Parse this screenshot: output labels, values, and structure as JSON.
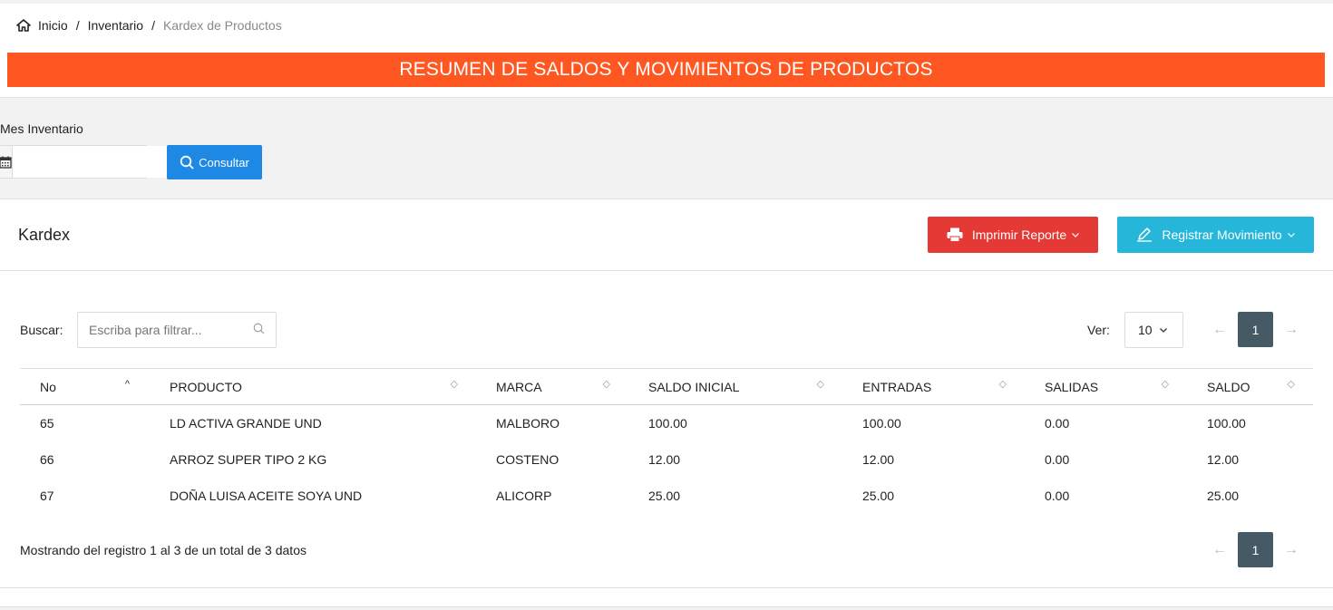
{
  "breadcrumb": {
    "home_icon": "home-icon",
    "items": [
      "Inicio",
      "Inventario",
      "Kardex de Productos"
    ],
    "separator": "/"
  },
  "banner": {
    "title": "RESUMEN DE SALDOS Y MOVIMIENTOS DE PRODUCTOS",
    "color": "#ff5722"
  },
  "filter": {
    "label": "Mes Inventario",
    "date_value": "",
    "calendar_icon": "calendar-icon",
    "consultar_label": "Consultar",
    "consultar_icon": "search-icon"
  },
  "card": {
    "title": "Kardex",
    "imprimir_label": "Imprimir Reporte",
    "imprimir_icon": "printer-icon",
    "registrar_label": "Registrar Movimiento",
    "registrar_icon": "pencil-icon",
    "colors": {
      "imprimir": "#e53935",
      "registrar": "#26b6d9",
      "consultar": "#1e88e5"
    }
  },
  "toolbar": {
    "search_label": "Buscar:",
    "search_placeholder": "Escriba para filtrar...",
    "search_value": "",
    "ver_label": "Ver:",
    "ver_value": "10"
  },
  "pagination": {
    "prev": "←",
    "next": "→",
    "current_page": "1"
  },
  "table": {
    "columns": [
      "No",
      "PRODUCTO",
      "MARCA",
      "SALDO INICIAL",
      "ENTRADAS",
      "SALIDAS",
      "SALDO"
    ],
    "rows": [
      [
        "65",
        "LD ACTIVA GRANDE UND",
        "MALBORO",
        "100.00",
        "100.00",
        "0.00",
        "100.00"
      ],
      [
        "66",
        "ARROZ SUPER TIPO 2 KG",
        "COSTENO",
        "12.00",
        "12.00",
        "0.00",
        "12.00"
      ],
      [
        "67",
        "DOÑA LUISA ACEITE SOYA UND",
        "ALICORP",
        "25.00",
        "25.00",
        "0.00",
        "25.00"
      ]
    ]
  },
  "footer": {
    "info": "Mostrando del registro 1 al 3 de un total de 3 datos"
  }
}
